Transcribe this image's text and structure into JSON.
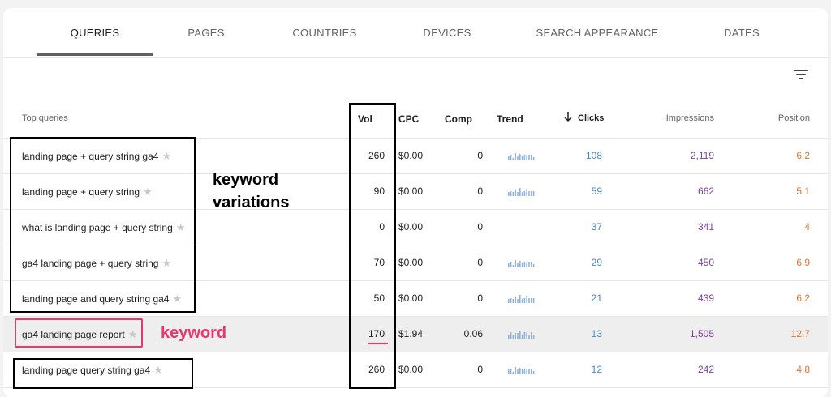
{
  "tabs": [
    {
      "label": "QUERIES",
      "active": true
    },
    {
      "label": "PAGES"
    },
    {
      "label": "COUNTRIES"
    },
    {
      "label": "DEVICES"
    },
    {
      "label": "SEARCH APPEARANCE"
    },
    {
      "label": "DATES"
    }
  ],
  "filter": {
    "icon": "filter-icon"
  },
  "columns": {
    "query": "Top queries",
    "vol": "Vol",
    "cpc": "CPC",
    "comp": "Comp",
    "trend": "Trend",
    "clicks": "Clicks",
    "impressions": "Impressions",
    "position": "Position"
  },
  "sort": {
    "column": "clicks",
    "direction": "descending",
    "icon": "arrow-down-icon"
  },
  "rows": [
    {
      "query": "landing page + query string ga4",
      "vol": "260",
      "cpc": "$0.00",
      "comp": "0",
      "trend": true,
      "clicks": "108",
      "impressions": "2,119",
      "position": "6.2"
    },
    {
      "query": "landing page + query string",
      "vol": "90",
      "cpc": "$0.00",
      "comp": "0",
      "trend": true,
      "clicks": "59",
      "impressions": "662",
      "position": "5.1"
    },
    {
      "query": "what is landing page + query string",
      "vol": "0",
      "cpc": "$0.00",
      "comp": "0",
      "trend": false,
      "clicks": "37",
      "impressions": "341",
      "position": "4"
    },
    {
      "query": "ga4 landing page + query string",
      "vol": "70",
      "cpc": "$0.00",
      "comp": "0",
      "trend": true,
      "clicks": "29",
      "impressions": "450",
      "position": "6.9"
    },
    {
      "query": "landing page and query string ga4",
      "vol": "50",
      "cpc": "$0.00",
      "comp": "0",
      "trend": true,
      "clicks": "21",
      "impressions": "439",
      "position": "6.2"
    },
    {
      "query": "ga4 landing page report",
      "vol": "170",
      "cpc": "$1.94",
      "comp": "0.06",
      "trend": true,
      "clicks": "13",
      "impressions": "1,505",
      "position": "12.7",
      "highlighted": true
    },
    {
      "query": "landing page query string ga4",
      "vol": "260",
      "cpc": "$0.00",
      "comp": "0",
      "trend": true,
      "clicks": "12",
      "impressions": "242",
      "position": "4.8"
    }
  ],
  "annotations": {
    "variations_line1": "keyword",
    "variations_line2": "variations",
    "keyword": "keyword",
    "box_color": "#000000",
    "keyword_color": "#e8386d"
  },
  "colors": {
    "clicks": "#4a86c8",
    "impressions": "#7b3fa0",
    "position": "#d9783a",
    "sparkline": "#8fb3e0"
  }
}
